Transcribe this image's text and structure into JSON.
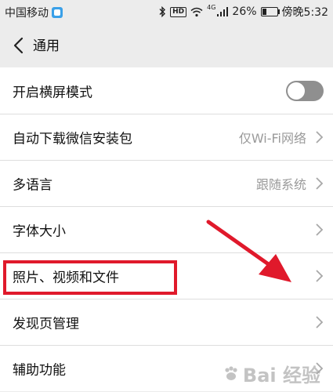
{
  "status_bar": {
    "carrier": "中国移动",
    "hd": "HD",
    "network": "4G",
    "battery_percent": "26%",
    "battery_level": 0.26,
    "time": "傍晚5:32"
  },
  "header": {
    "title": "通用"
  },
  "settings": {
    "items": [
      {
        "label": "开启横屏模式",
        "value": "",
        "control": "toggle",
        "toggle_on": false
      },
      {
        "label": "自动下载微信安装包",
        "value": "仅Wi-Fi网络",
        "control": "chevron"
      },
      {
        "label": "多语言",
        "value": "跟随系统",
        "control": "chevron"
      },
      {
        "label": "字体大小",
        "value": "",
        "control": "chevron"
      },
      {
        "label": "照片、视频和文件",
        "value": "",
        "control": "chevron"
      },
      {
        "label": "发现页管理",
        "value": "",
        "control": "chevron"
      },
      {
        "label": "辅助功能",
        "value": "",
        "control": "chevron"
      }
    ]
  },
  "annotations": {
    "highlight_color": "#e0192b",
    "arrow_color": "#e0192b"
  },
  "watermark": {
    "text": "Bai 经验"
  }
}
